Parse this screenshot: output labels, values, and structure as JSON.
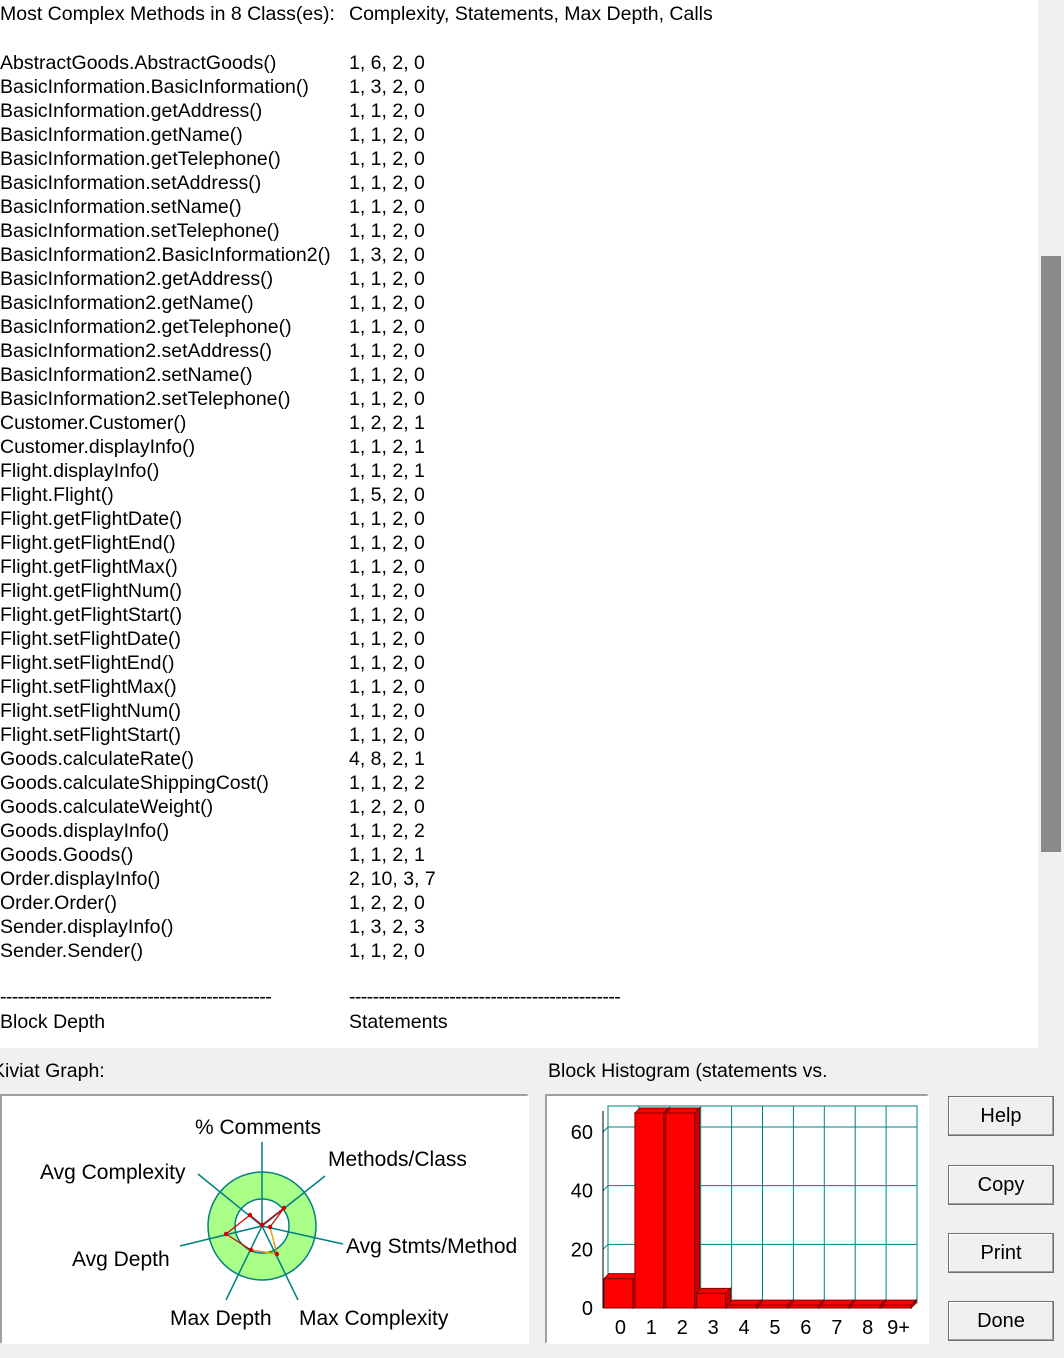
{
  "report": {
    "header_title": "Most Complex Methods in 8 Class(es):",
    "header_columns": "Complexity, Statements, Max Depth, Calls",
    "methods": [
      {
        "name": "AbstractGoods.AbstractGoods()",
        "values": "1, 6, 2, 0"
      },
      {
        "name": "BasicInformation.BasicInformation()",
        "values": "1, 3, 2, 0"
      },
      {
        "name": "BasicInformation.getAddress()",
        "values": "1, 1, 2, 0"
      },
      {
        "name": "BasicInformation.getName()",
        "values": "1, 1, 2, 0"
      },
      {
        "name": "BasicInformation.getTelephone()",
        "values": "1, 1, 2, 0"
      },
      {
        "name": "BasicInformation.setAddress()",
        "values": "1, 1, 2, 0"
      },
      {
        "name": "BasicInformation.setName()",
        "values": "1, 1, 2, 0"
      },
      {
        "name": "BasicInformation.setTelephone()",
        "values": "1, 1, 2, 0"
      },
      {
        "name": "BasicInformation2.BasicInformation2()",
        "values": "1, 3, 2, 0"
      },
      {
        "name": "BasicInformation2.getAddress()",
        "values": "1, 1, 2, 0"
      },
      {
        "name": "BasicInformation2.getName()",
        "values": "1, 1, 2, 0"
      },
      {
        "name": "BasicInformation2.getTelephone()",
        "values": "1, 1, 2, 0"
      },
      {
        "name": "BasicInformation2.setAddress()",
        "values": "1, 1, 2, 0"
      },
      {
        "name": "BasicInformation2.setName()",
        "values": "1, 1, 2, 0"
      },
      {
        "name": "BasicInformation2.setTelephone()",
        "values": "1, 1, 2, 0"
      },
      {
        "name": "Customer.Customer()",
        "values": "1, 2, 2, 1"
      },
      {
        "name": "Customer.displayInfo()",
        "values": "1, 1, 2, 1"
      },
      {
        "name": "Flight.displayInfo()",
        "values": "1, 1, 2, 1"
      },
      {
        "name": "Flight.Flight()",
        "values": "1, 5, 2, 0"
      },
      {
        "name": "Flight.getFlightDate()",
        "values": "1, 1, 2, 0"
      },
      {
        "name": "Flight.getFlightEnd()",
        "values": "1, 1, 2, 0"
      },
      {
        "name": "Flight.getFlightMax()",
        "values": "1, 1, 2, 0"
      },
      {
        "name": "Flight.getFlightNum()",
        "values": "1, 1, 2, 0"
      },
      {
        "name": "Flight.getFlightStart()",
        "values": "1, 1, 2, 0"
      },
      {
        "name": "Flight.setFlightDate()",
        "values": "1, 1, 2, 0"
      },
      {
        "name": "Flight.setFlightEnd()",
        "values": "1, 1, 2, 0"
      },
      {
        "name": "Flight.setFlightMax()",
        "values": "1, 1, 2, 0"
      },
      {
        "name": "Flight.setFlightNum()",
        "values": "1, 1, 2, 0"
      },
      {
        "name": "Flight.setFlightStart()",
        "values": "1, 1, 2, 0"
      },
      {
        "name": "Goods.calculateRate()",
        "values": "4, 8, 2, 1"
      },
      {
        "name": "Goods.calculateShippingCost()",
        "values": "1, 1, 2, 2"
      },
      {
        "name": "Goods.calculateWeight()",
        "values": "1, 2, 2, 0"
      },
      {
        "name": "Goods.displayInfo()",
        "values": "1, 1, 2, 2"
      },
      {
        "name": "Goods.Goods()",
        "values": "1, 1, 2, 1"
      },
      {
        "name": "Order.displayInfo()",
        "values": "2, 10, 3, 7"
      },
      {
        "name": "Order.Order()",
        "values": "1, 2, 2, 0"
      },
      {
        "name": "Sender.displayInfo()",
        "values": "1, 3, 2, 3"
      },
      {
        "name": "Sender.Sender()",
        "values": "1, 1, 2, 0"
      }
    ],
    "dashes_left": "----------------------------------------------",
    "dashes_right": "----------------------------------------------",
    "footer_left": "Block Depth",
    "footer_right": "Statements"
  },
  "kiviat": {
    "title": "Kiviat Graph:",
    "axis_labels": {
      "comments": "% Comments",
      "methods_per_class": "Methods/Class",
      "avg_complexity": "Avg Complexity",
      "avg_stmts_method": "Avg Stmts/Method",
      "avg_depth": "Avg Depth",
      "max_depth": "Max Depth",
      "max_complexity": "Max Complexity"
    },
    "ring_color": "#aaff88",
    "axis_color": "#008080",
    "polygon_color": "#cc0000"
  },
  "histogram": {
    "title": "Block Histogram (statements vs.",
    "bar_color": "#ff0000",
    "grid_color": "#008080"
  },
  "chart_data": {
    "type": "bar",
    "categories": [
      "0",
      "1",
      "2",
      "3",
      "4",
      "5",
      "6",
      "7",
      "8",
      "9+"
    ],
    "values": [
      10,
      70,
      70,
      5,
      1,
      1,
      1,
      1,
      1,
      1
    ],
    "yticks": [
      "0",
      "20",
      "40",
      "60"
    ],
    "ylim": [
      0,
      70
    ],
    "grid": true
  },
  "buttons": {
    "help": "Help",
    "copy": "Copy",
    "print": "Print",
    "done": "Done"
  }
}
